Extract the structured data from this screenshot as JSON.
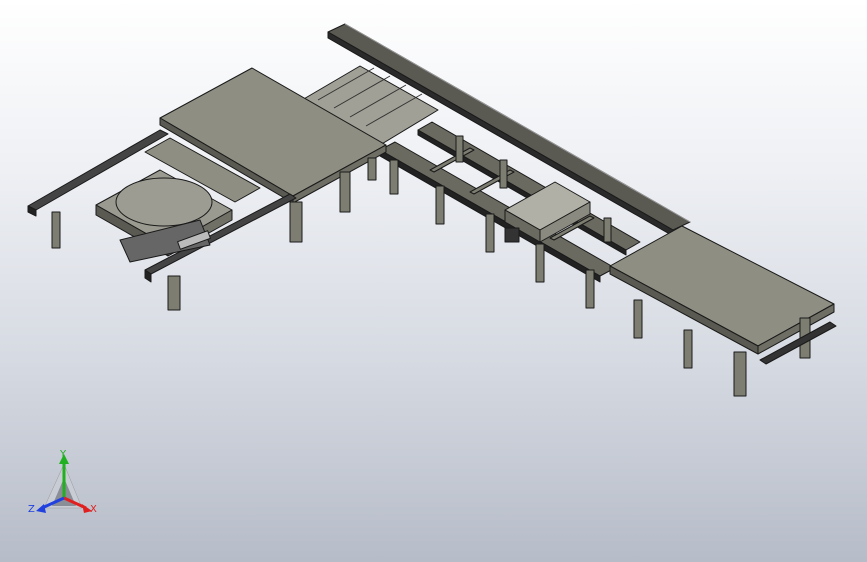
{
  "viewport": {
    "background_top": "#ffffff",
    "background_bottom": "#b6bcc8"
  },
  "model": {
    "edge_color": "#1a1a1a",
    "table_top_color": "#8e8e82",
    "frame_color": "#7d7d72",
    "rail_color": "#2a2a2a"
  },
  "triad": {
    "x_label": "X",
    "y_label": "Y",
    "z_label": "Z",
    "x_color": "#e02020",
    "y_color": "#20b020",
    "z_color": "#2040e0"
  }
}
